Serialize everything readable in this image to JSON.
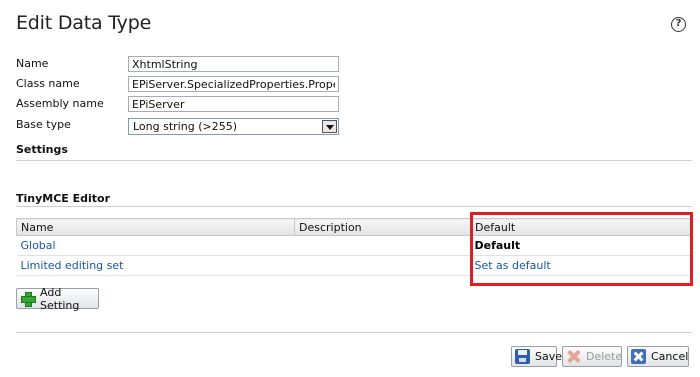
{
  "page": {
    "title": "Edit Data Type",
    "help_glyph": "?"
  },
  "form": {
    "name_label": "Name",
    "name_value": "XhtmlString",
    "class_label": "Class name",
    "class_value": "EPiServer.SpecializedProperties.PropertyX",
    "assembly_label": "Assembly name",
    "assembly_value": "EPiServer",
    "base_type_label": "Base type",
    "base_type_value": "Long string (>255)"
  },
  "sections": {
    "settings": "Settings",
    "tinymce": "TinyMCE Editor"
  },
  "grid": {
    "columns": [
      "Name",
      "Description",
      "Default"
    ],
    "rows": [
      {
        "name": "Global",
        "description": "",
        "default": "Default"
      },
      {
        "name": "Limited editing set",
        "description": "",
        "default": "Set as default"
      }
    ]
  },
  "buttons": {
    "add_setting": "Add Setting",
    "save": "Save",
    "delete": "Delete",
    "cancel": "Cancel"
  },
  "icons": {
    "help": "help-icon",
    "add": "plus-icon",
    "save": "floppy-disk-icon",
    "delete": "x-icon",
    "cancel": "cancel-icon"
  },
  "colors": {
    "link": "#1a55a8",
    "highlight": "#e51c23",
    "add_icon": "#3aa536"
  }
}
